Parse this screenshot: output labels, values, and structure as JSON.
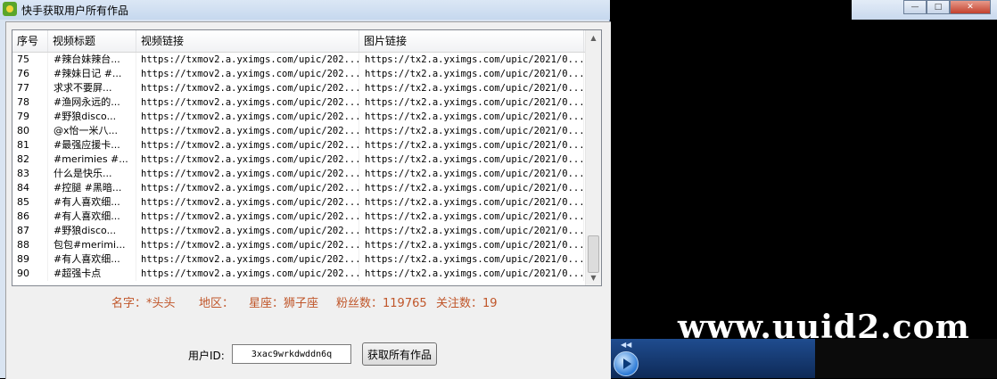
{
  "window": {
    "title": "快手获取用户所有作品"
  },
  "table": {
    "columns": [
      "序号",
      "视频标题",
      "视频链接",
      "图片链接"
    ],
    "rows": [
      [
        "75",
        "#辣台妹辣台...",
        "https://txmov2.a.yximgs.com/upic/202...",
        "https://tx2.a.yximgs.com/upic/2021/0..."
      ],
      [
        "76",
        "#辣妹日记 #...",
        "https://txmov2.a.yximgs.com/upic/202...",
        "https://tx2.a.yximgs.com/upic/2021/0..."
      ],
      [
        "77",
        "求求不要屏...",
        "https://txmov2.a.yximgs.com/upic/202...",
        "https://tx2.a.yximgs.com/upic/2021/0..."
      ],
      [
        "78",
        "#渔网永远的...",
        "https://txmov2.a.yximgs.com/upic/202...",
        "https://tx2.a.yximgs.com/upic/2021/0..."
      ],
      [
        "79",
        "#野狼disco...",
        "https://txmov2.a.yximgs.com/upic/202...",
        "https://tx2.a.yximgs.com/upic/2021/0..."
      ],
      [
        "80",
        "@x怡一米八...",
        "https://txmov2.a.yximgs.com/upic/202...",
        "https://tx2.a.yximgs.com/upic/2021/0..."
      ],
      [
        "81",
        "#最强应援卡...",
        "https://txmov2.a.yximgs.com/upic/202...",
        "https://tx2.a.yximgs.com/upic/2021/0..."
      ],
      [
        "82",
        "#merimies #...",
        "https://txmov2.a.yximgs.com/upic/202...",
        "https://tx2.a.yximgs.com/upic/2021/0..."
      ],
      [
        "83",
        "什么是快乐...",
        "https://txmov2.a.yximgs.com/upic/202...",
        "https://tx2.a.yximgs.com/upic/2021/0..."
      ],
      [
        "84",
        "#控腿 #黑暗...",
        "https://txmov2.a.yximgs.com/upic/202...",
        "https://tx2.a.yximgs.com/upic/2021/0..."
      ],
      [
        "85",
        "#有人喜欢细...",
        "https://txmov2.a.yximgs.com/upic/202...",
        "https://tx2.a.yximgs.com/upic/2021/0..."
      ],
      [
        "86",
        "#有人喜欢细...",
        "https://txmov2.a.yximgs.com/upic/202...",
        "https://tx2.a.yximgs.com/upic/2021/0..."
      ],
      [
        "87",
        "#野狼disco...",
        "https://txmov2.a.yximgs.com/upic/202...",
        "https://tx2.a.yximgs.com/upic/2021/0..."
      ],
      [
        "88",
        "包包#merimi...",
        "https://txmov2.a.yximgs.com/upic/202...",
        "https://tx2.a.yximgs.com/upic/2021/0..."
      ],
      [
        "89",
        "#有人喜欢细...",
        "https://txmov2.a.yximgs.com/upic/202...",
        "https://tx2.a.yximgs.com/upic/2021/0..."
      ],
      [
        "90",
        "#超强卡点",
        "https://txmov2.a.yximgs.com/upic/202...",
        "https://tx2.a.yximgs.com/upic/2021/0..."
      ]
    ]
  },
  "info": {
    "name": "名字：*头头",
    "region": "地区：",
    "zodiac": "星座：狮子座",
    "fans": "粉丝数：119765",
    "following": "关注数：19",
    "color": "#c0562a"
  },
  "form": {
    "uid_label": "用户ID:",
    "uid_value": "3xac9wrkdwddn6q",
    "fetch_button": "获取所有作品"
  },
  "background": {
    "watermark": "www.uuid2.com"
  },
  "icons": {
    "app": "kuaishou-app-icon",
    "play": "media-play-icon"
  }
}
